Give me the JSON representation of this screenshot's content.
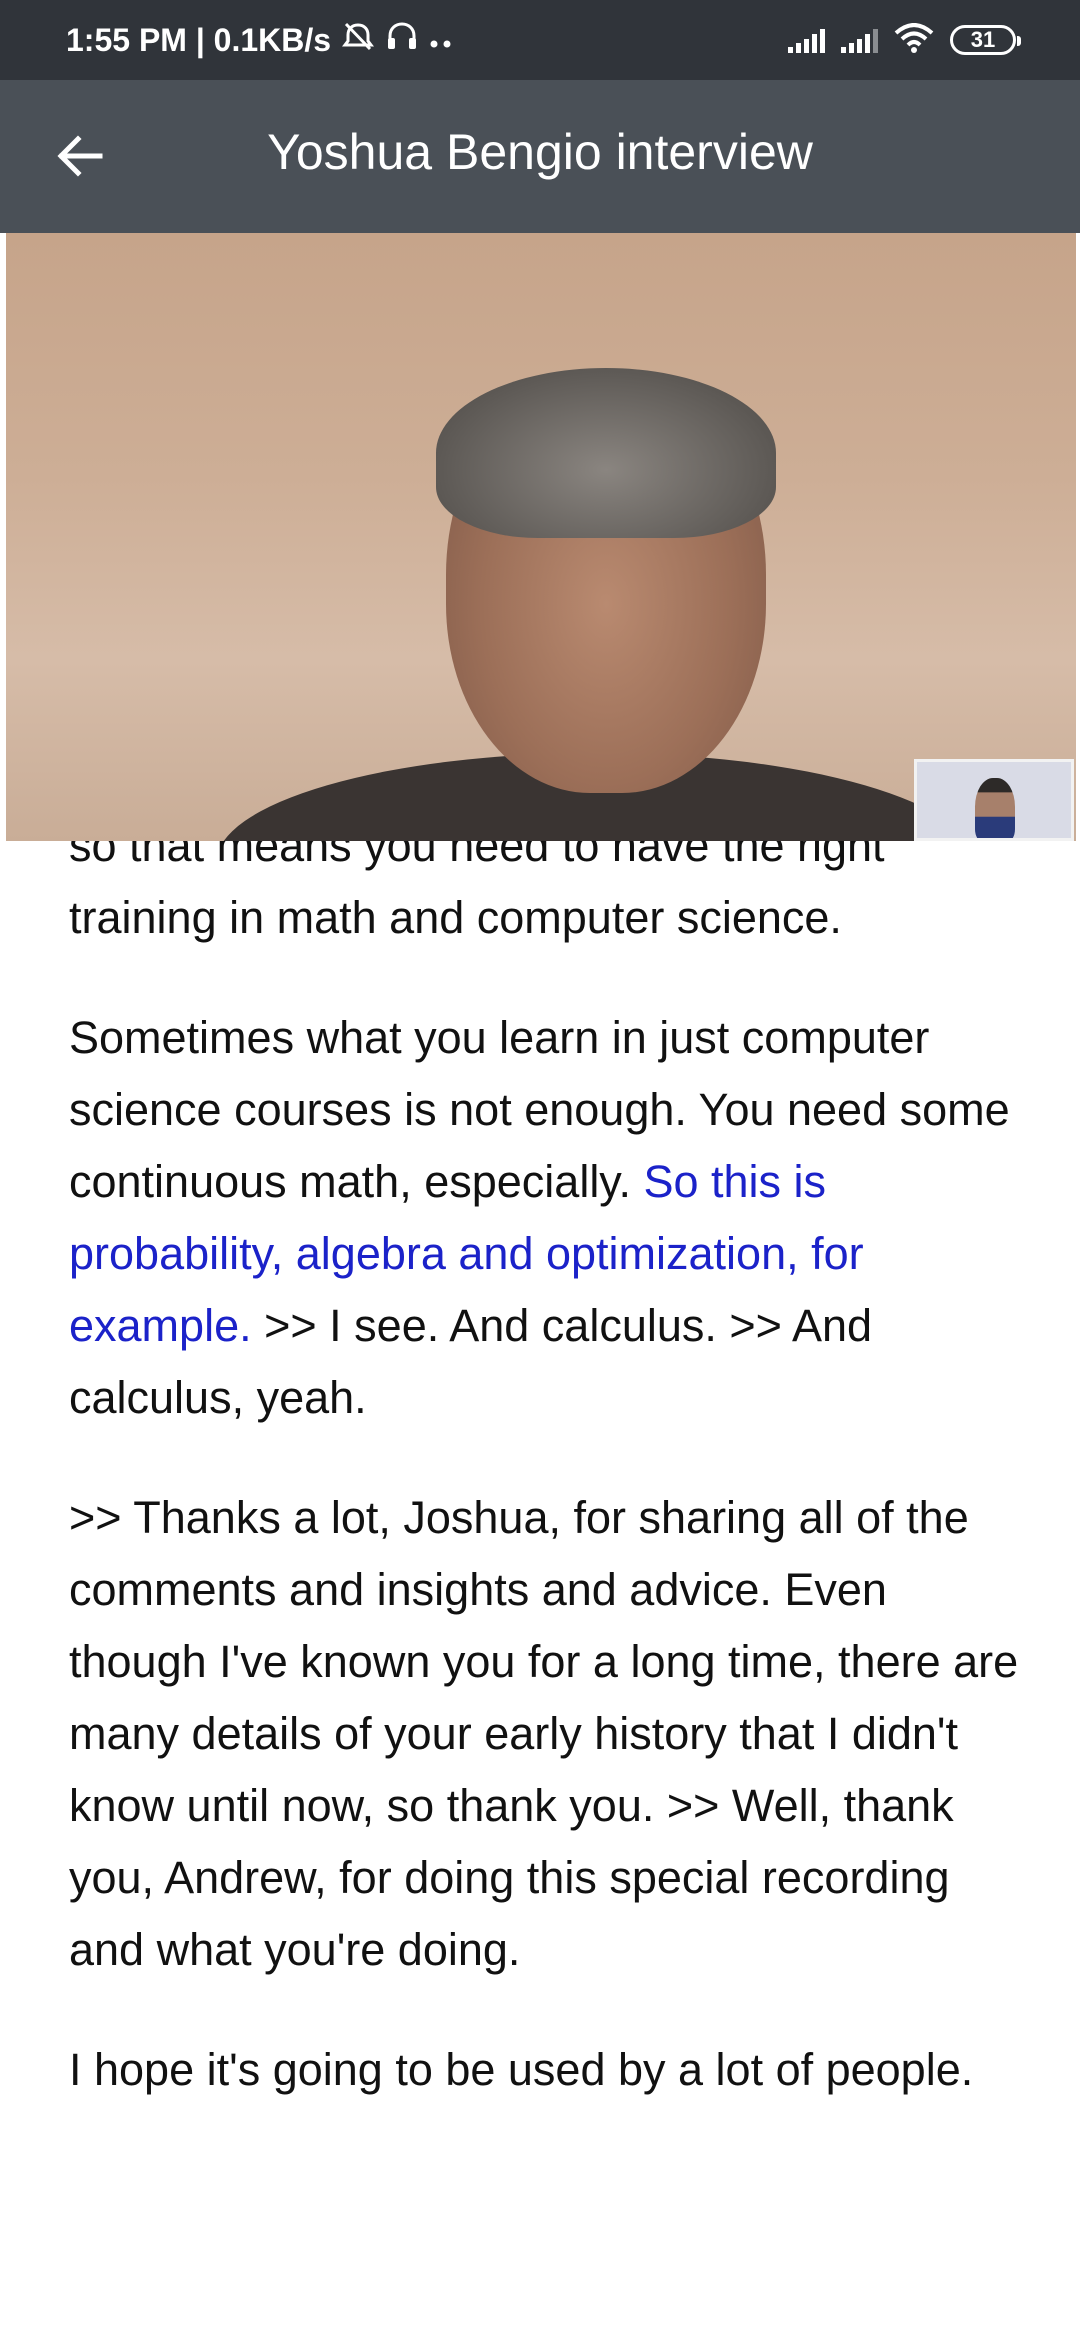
{
  "status_bar": {
    "time_speed": "1:55 PM | 0.1KB/s",
    "battery": "31",
    "icons": [
      "alarm-off-icon",
      "headset-icon",
      "more-dots-icon",
      "signal-icon",
      "signal-icon",
      "wifi-icon",
      "battery-icon"
    ]
  },
  "app_bar": {
    "title": "Yoshua Bengio interview",
    "back_icon": "arrow-back-icon"
  },
  "transcript": {
    "p1": "so that means you need to have the right training in math and computer science.",
    "p2_a": "Sometimes what you learn in just computer science courses is not enough. You need some continuous math, especially. ",
    "p2_highlight": "So this is probability, algebra and optimization, for example.",
    "p2_b": " >> I see. And calculus. >> And calculus, yeah.",
    "p3": ">> Thanks a lot, Joshua, for sharing all of the comments and insights and advice. Even though I've known you for a long time, there are many details of your early history that I didn't know until now, so thank you. >> Well, thank you, Andrew, for doing this special recording and what you're doing.",
    "p4": "I hope it's going to be used by a lot of people."
  },
  "colors": {
    "status_bar": "#30343a",
    "app_bar": "#4a5057",
    "highlight": "#1b22c9"
  }
}
